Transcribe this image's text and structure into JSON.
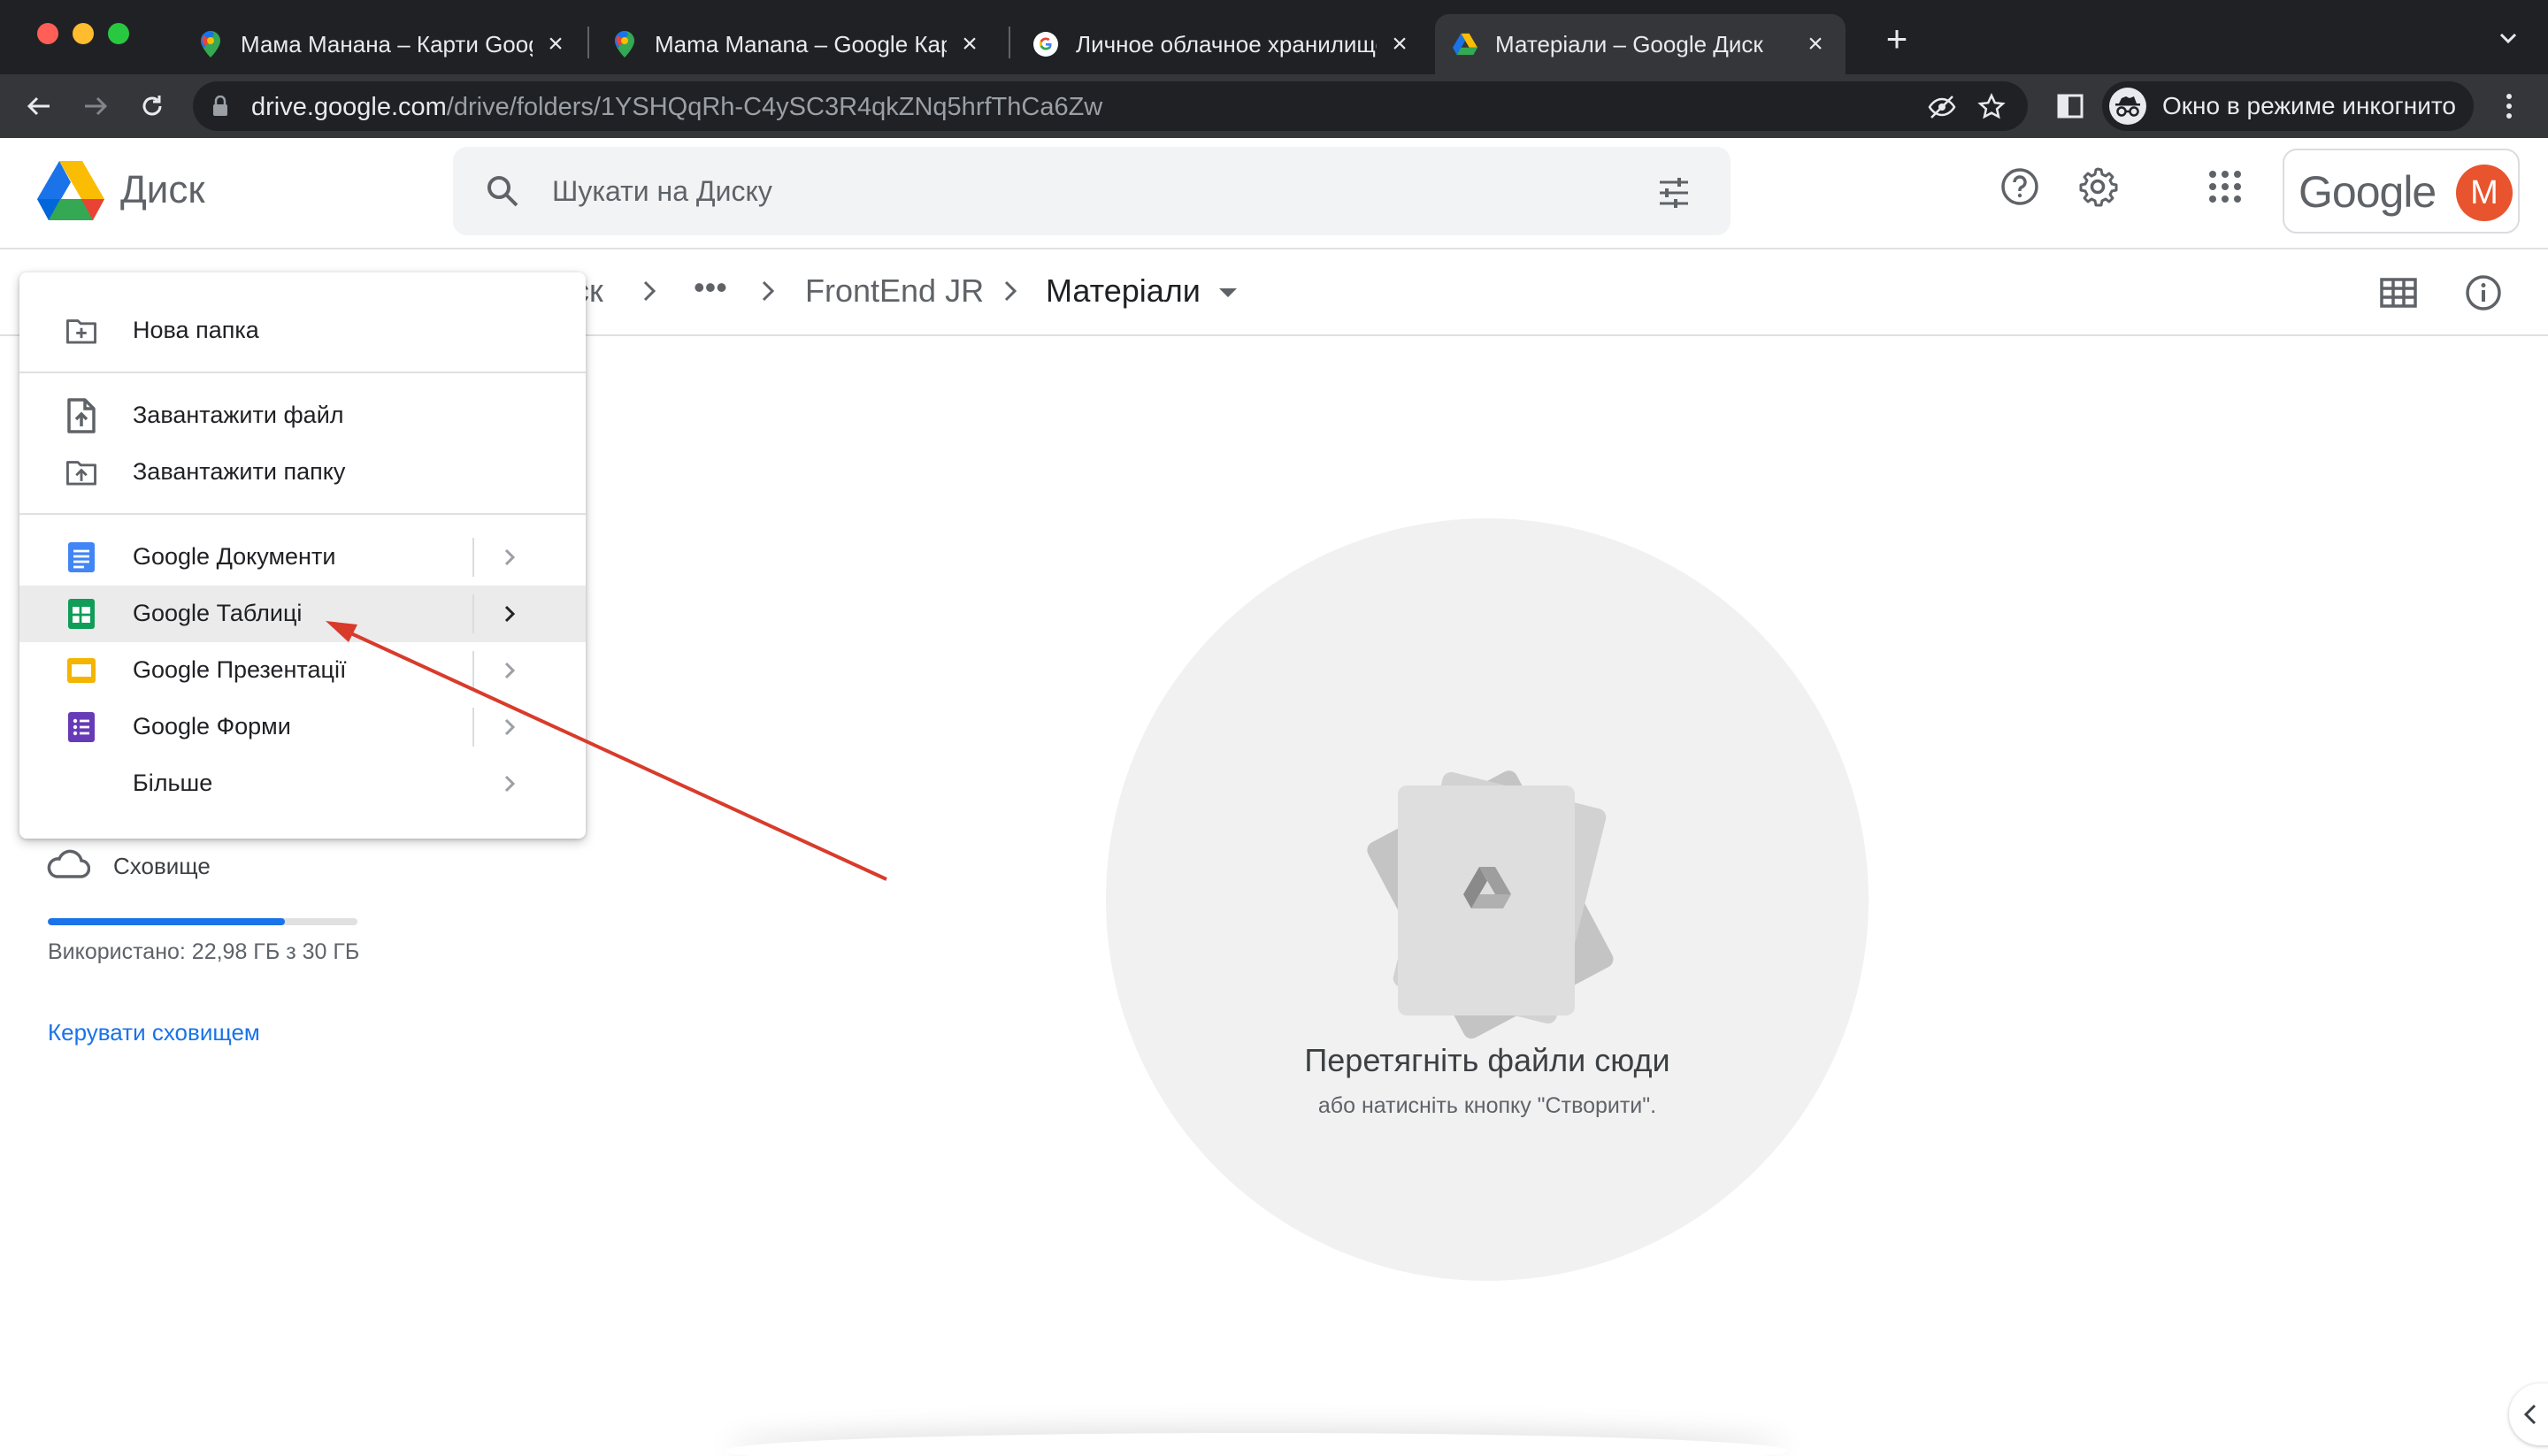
{
  "browser": {
    "tabs": [
      {
        "title": "Мама Манана – Карти Google",
        "icon": "maps-pin-icon",
        "active": false
      },
      {
        "title": "Mama Manana – Google Карты",
        "icon": "maps-pin-icon",
        "active": false
      },
      {
        "title": "Личное облачное хранилище",
        "icon": "google-g-icon",
        "active": false
      },
      {
        "title": "Матеріали – Google Диск",
        "icon": "drive-icon",
        "active": true
      }
    ],
    "url_domain": "drive.google.com",
    "url_path": "/drive/folders/1YSHQqRh-C4ySC3R4qkZNq5hrfThCa6Zw",
    "incognito_label": "Окно в режиме инкогнито"
  },
  "header": {
    "app_name": "Диск",
    "search_placeholder": "Шукати на Диску",
    "brand_word": "Google",
    "avatar_letter": "M",
    "avatar_color": "#e8542e"
  },
  "breadcrumb": {
    "partial_root": "ск",
    "ellipsis": "•••",
    "parent": "FrontEnd JR",
    "current": "Матеріали"
  },
  "new_menu": {
    "items": [
      {
        "label": "Нова папка",
        "icon": "new-folder-icon"
      },
      {
        "label": "Завантажити файл",
        "icon": "file-upload-icon"
      },
      {
        "label": "Завантажити папку",
        "icon": "folder-upload-icon"
      },
      {
        "label": "Google Документи",
        "icon": "docs-icon",
        "submenu": true
      },
      {
        "label": "Google Таблиці",
        "icon": "sheets-icon",
        "submenu": true,
        "highlighted": true
      },
      {
        "label": "Google Презентації",
        "icon": "slides-icon",
        "submenu": true
      },
      {
        "label": "Google Форми",
        "icon": "forms-icon",
        "submenu": true
      },
      {
        "label": "Більше",
        "icon": null,
        "submenu": true
      }
    ]
  },
  "sidebar": {
    "storage_label": "Сховище",
    "storage_used_text": "Використано: 22,98 ГБ з 30 ГБ",
    "storage_fraction": 0.766,
    "manage_storage": "Керувати сховищем"
  },
  "empty_state": {
    "title": "Перетягніть файли сюди",
    "subtitle": "або натисніть кнопку \"Створити\"."
  },
  "colors": {
    "accent_blue": "#1a73e8",
    "annotation_arrow": "#d93b2b"
  }
}
